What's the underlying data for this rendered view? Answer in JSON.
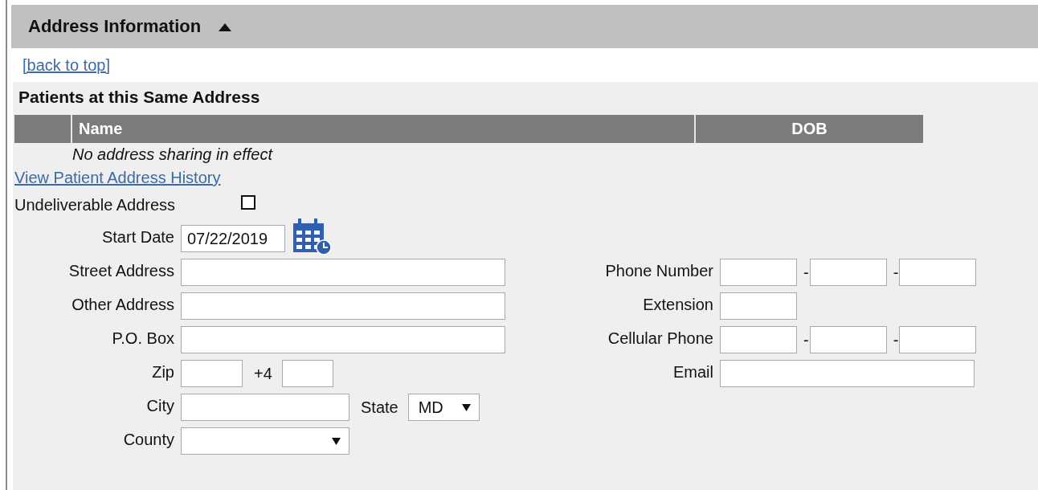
{
  "section": {
    "title": "Address Information",
    "expanded": true
  },
  "back_link": "[back to top]",
  "shared": {
    "title": "Patients at this Same Address",
    "columns": [
      "Name",
      "DOB"
    ],
    "empty_message": "No address sharing in effect"
  },
  "history_link": "View Patient Address History",
  "undeliverable": {
    "label": "Undeliverable Address",
    "checked": false
  },
  "left_fields": [
    {
      "kind": "date",
      "label": "Start Date",
      "value": "07/22/2019"
    },
    {
      "kind": "text",
      "label": "Street Address"
    },
    {
      "kind": "text",
      "label": "Other Address"
    },
    {
      "kind": "text",
      "label": "P.O. Box"
    },
    {
      "kind": "zip",
      "label": "Zip",
      "plus_label": "+4"
    },
    {
      "kind": "city",
      "label": "City",
      "state_label": "State",
      "state_value": "MD"
    },
    {
      "kind": "select",
      "label": "County"
    }
  ],
  "right_fields": [
    {
      "kind": "phone",
      "label": "Phone Number",
      "separators": [
        "-",
        "-"
      ]
    },
    {
      "kind": "short",
      "label": "Extension"
    },
    {
      "kind": "phone",
      "label": "Cellular Phone",
      "separators": [
        "-",
        "-"
      ]
    },
    {
      "kind": "long",
      "label": "Email"
    }
  ]
}
